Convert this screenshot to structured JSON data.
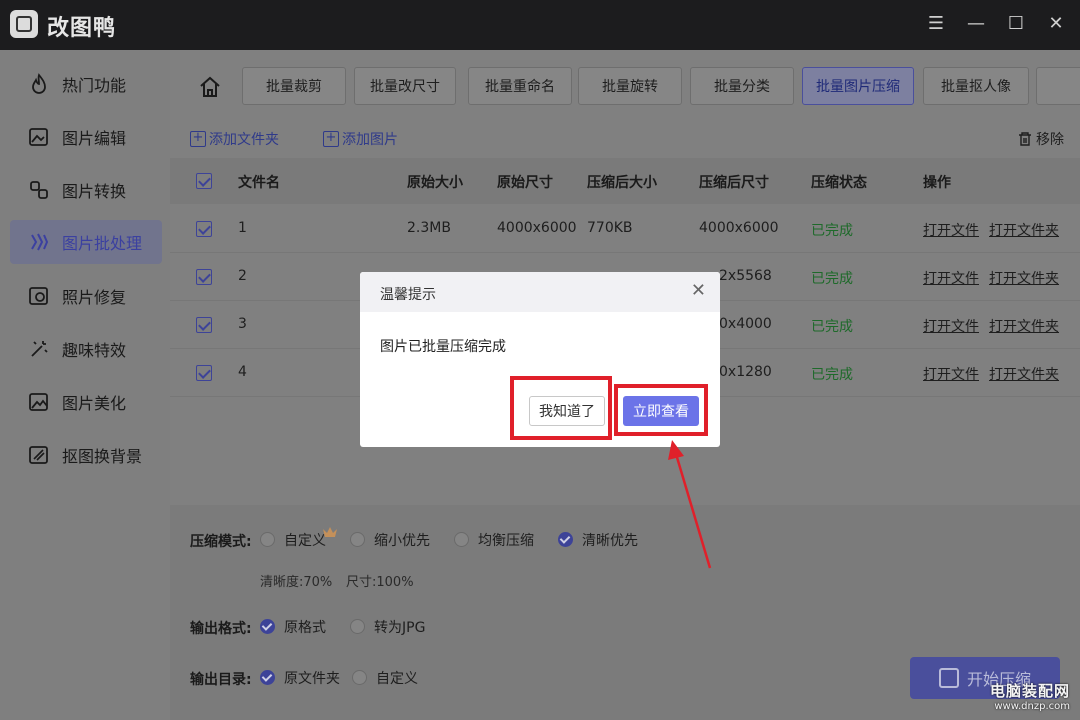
{
  "app": {
    "title": "改图鸭"
  },
  "window_controls": [
    "menu-icon",
    "minimize-icon",
    "maximize-icon",
    "close-icon"
  ],
  "sidebar": {
    "items": [
      {
        "label": "热门功能",
        "icon": "flame-icon"
      },
      {
        "label": "图片编辑",
        "icon": "image-edit-icon"
      },
      {
        "label": "图片转换",
        "icon": "convert-icon"
      },
      {
        "label": "图片批处理",
        "icon": "batch-icon",
        "active": true
      },
      {
        "label": "照片修复",
        "icon": "photo-repair-icon"
      },
      {
        "label": "趣味特效",
        "icon": "magic-wand-icon"
      },
      {
        "label": "图片美化",
        "icon": "beautify-icon"
      },
      {
        "label": "抠图换背景",
        "icon": "cutout-icon"
      }
    ]
  },
  "tabs": [
    {
      "label": "批量裁剪"
    },
    {
      "label": "批量改尺寸"
    },
    {
      "label": "批量重命名"
    },
    {
      "label": "批量旋转"
    },
    {
      "label": "批量分类"
    },
    {
      "label": "批量图片压缩",
      "active": true
    },
    {
      "label": "批量抠人像"
    }
  ],
  "toolbar": {
    "add_folder": "添加文件夹",
    "add_image": "添加图片",
    "remove": "移除"
  },
  "table": {
    "columns": [
      "文件名",
      "原始大小",
      "原始尺寸",
      "压缩后大小",
      "压缩后尺寸",
      "压缩状态",
      "操作"
    ],
    "rows": [
      {
        "name": "1",
        "orig_size": "2.3MB",
        "orig_dim": "4000x6000",
        "new_size": "770KB",
        "new_dim": "4000x6000",
        "status": "已完成"
      },
      {
        "name": "2",
        "orig_size": "",
        "orig_dim": "",
        "new_size": "",
        "new_dim": "2x5568",
        "status": "已完成"
      },
      {
        "name": "3",
        "orig_size": "",
        "orig_dim": "",
        "new_size": "",
        "new_dim": "0x4000",
        "status": "已完成"
      },
      {
        "name": "4",
        "orig_size": "",
        "orig_dim": "",
        "new_size": "",
        "new_dim": "0x1280",
        "status": "已完成"
      }
    ],
    "action_open_file": "打开文件",
    "action_open_folder": "打开文件夹"
  },
  "settings": {
    "mode_label": "压缩模式:",
    "modes": [
      {
        "label": "自定义",
        "selected": false
      },
      {
        "label": "缩小优先",
        "selected": false
      },
      {
        "label": "均衡压缩",
        "selected": false
      },
      {
        "label": "清晰优先",
        "selected": true
      }
    ],
    "clarity": "清晰度:70%",
    "size": "尺寸:100%",
    "format_label": "输出格式:",
    "formats": [
      {
        "label": "原格式",
        "selected": true
      },
      {
        "label": "转为JPG",
        "selected": false
      }
    ],
    "dir_label": "输出目录:",
    "dirs": [
      {
        "label": "原文件夹",
        "selected": true
      },
      {
        "label": "自定义",
        "selected": false
      }
    ],
    "start_button": "开始压缩"
  },
  "dialog": {
    "title": "温馨提示",
    "message": "图片已批量压缩完成",
    "ack_button": "我知道了",
    "view_button": "立即查看"
  },
  "watermark": {
    "brand": "电脑装配网",
    "url": "www.dnzp.com"
  },
  "colors": {
    "accent": "#6b73e8",
    "highlight": "#e0202a",
    "status_done": "#1e6a2a"
  }
}
